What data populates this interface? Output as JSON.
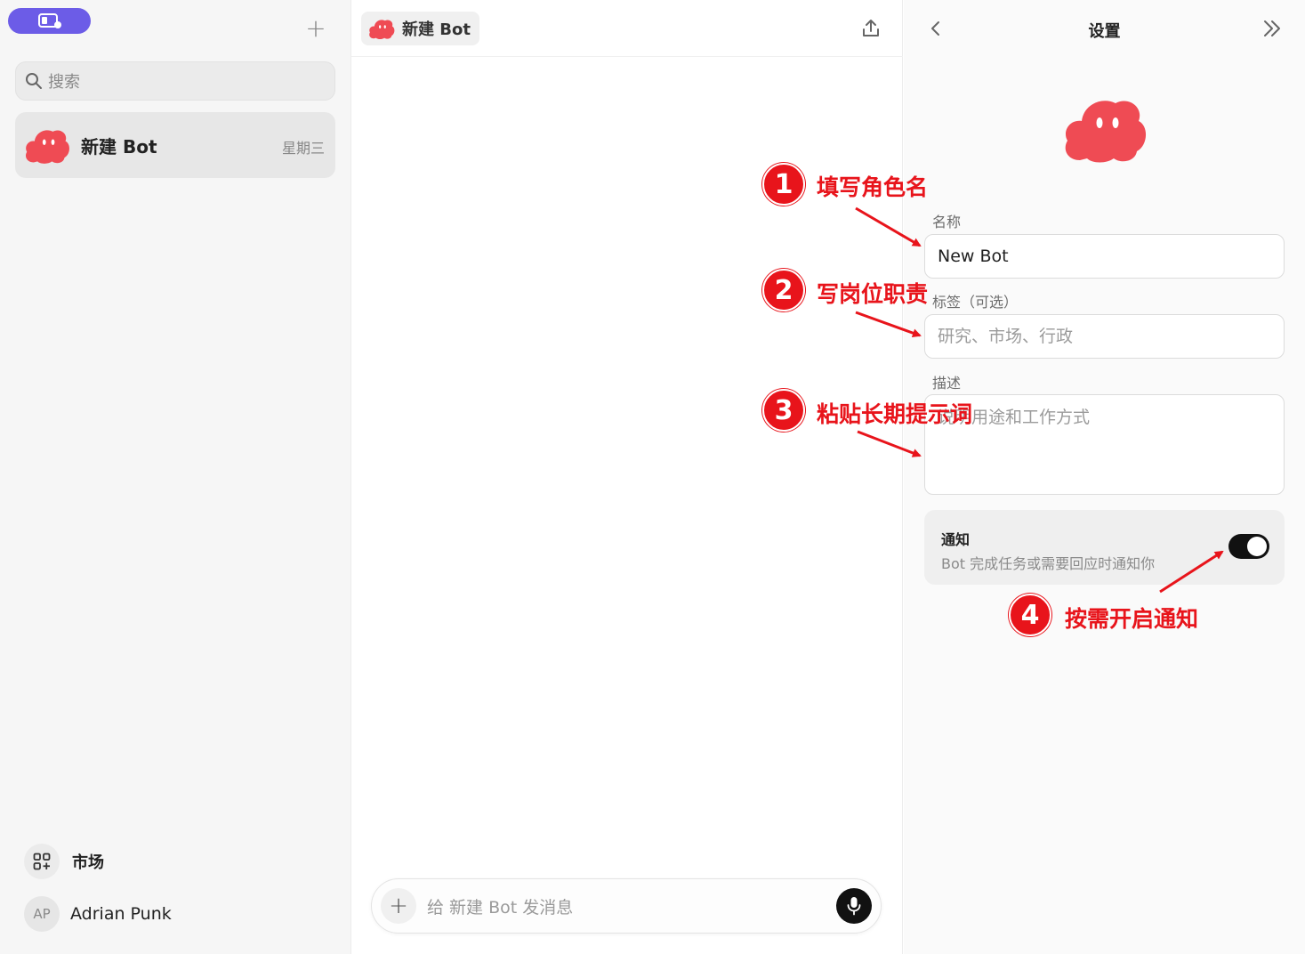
{
  "sidebar": {
    "search_placeholder": "搜索",
    "chat_item": {
      "name": "新建 Bot",
      "date": "星期三"
    },
    "market_label": "市场",
    "user": {
      "initials": "AP",
      "name": "Adrian Punk"
    }
  },
  "main": {
    "bot_chip_name": "新建 Bot",
    "composer_placeholder": "给 新建 Bot 发消息"
  },
  "settings": {
    "title": "设置",
    "name_label": "名称",
    "name_value": "New Bot",
    "tag_label": "标签（可选）",
    "tag_placeholder": "研究、市场、行政",
    "desc_label": "描述",
    "desc_placeholder": "说明用途和工作方式",
    "notify_title": "通知",
    "notify_desc": "Bot 完成任务或需要回应时通知你",
    "notify_enabled": true
  },
  "annotations": [
    {
      "num": "1",
      "text": "填写角色名"
    },
    {
      "num": "2",
      "text": "写岗位职责"
    },
    {
      "num": "3",
      "text": "粘贴长期提示词"
    },
    {
      "num": "4",
      "text": "按需开启通知"
    }
  ],
  "colors": {
    "accent": "#6c5ce7",
    "bot_red": "#ef4b54",
    "annotation_red": "#e8141b"
  }
}
